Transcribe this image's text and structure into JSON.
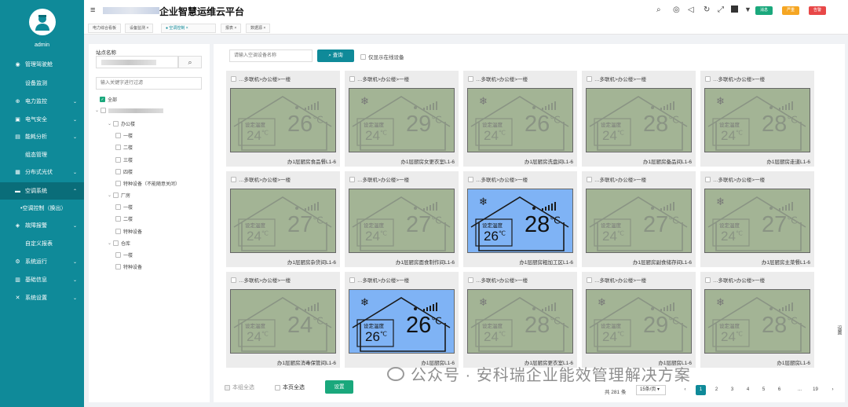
{
  "user": {
    "name": "admin"
  },
  "app": {
    "title": "企业智慧运维云平台"
  },
  "sidebar": {
    "items": [
      {
        "label": "管理驾驶舱",
        "icon": "dashboard-icon"
      },
      {
        "label": "设备监测",
        "icon": ""
      },
      {
        "label": "电力监控",
        "icon": "power-icon"
      },
      {
        "label": "电气安全",
        "icon": "shield-icon"
      },
      {
        "label": "能耗分析",
        "icon": "chart-icon"
      },
      {
        "label": "组态管理",
        "icon": ""
      },
      {
        "label": "分布式光伏",
        "icon": "solar-icon"
      },
      {
        "label": "空调系统",
        "icon": "aircon-icon"
      },
      {
        "label": "空调控制（换出）",
        "icon": ""
      },
      {
        "label": "故障报警",
        "icon": "alarm-icon"
      },
      {
        "label": "自定义报表",
        "icon": ""
      },
      {
        "label": "系统运行",
        "icon": "run-icon"
      },
      {
        "label": "基础信息",
        "icon": "info-icon"
      },
      {
        "label": "系统设置",
        "icon": "wrench-icon"
      }
    ]
  },
  "header_badges": [
    {
      "label": "消息",
      "color": "#1aa87c"
    },
    {
      "label": "严重",
      "color": "#f5a623"
    },
    {
      "label": "告警",
      "color": "#e84848"
    }
  ],
  "tabs": [
    {
      "label": "电力综合看板"
    },
    {
      "label": "设备监测 ×"
    },
    {
      "label": "● 空调控制 ×"
    },
    {
      "label": "报表 ×"
    },
    {
      "label": "数据源 ×"
    }
  ],
  "tree": {
    "station_label": "站点名称",
    "filter_placeholder": "输入关键字进行过滤",
    "nodes": [
      {
        "label": "全部"
      },
      {
        "label": "办公楼"
      },
      {
        "label": "一楼"
      },
      {
        "label": "二楼"
      },
      {
        "label": "三楼"
      },
      {
        "label": "四楼"
      },
      {
        "label": "特种设备（不能随意关闭）"
      },
      {
        "label": "厂房"
      },
      {
        "label": "一楼"
      },
      {
        "label": "二楼"
      },
      {
        "label": "特种设备"
      },
      {
        "label": "仓库"
      },
      {
        "label": "一楼"
      },
      {
        "label": "特种设备"
      }
    ]
  },
  "search": {
    "placeholder": "请输入空调设备名称",
    "button": "查询",
    "only_online": "仅显示在线设备"
  },
  "cards": [
    {
      "path": "…多联机>办公楼>一楼",
      "name": "办1层厨房食品餐L1-6",
      "set": "24",
      "cur": "26",
      "snow": false,
      "on": false
    },
    {
      "path": "…多联机>办公楼>一楼",
      "name": "办1层厨房女更衣室L1-6",
      "set": "24",
      "cur": "29",
      "snow": true,
      "on": false
    },
    {
      "path": "…多联机>办公楼>一楼",
      "name": "办1层厨房洗盘间L1-6",
      "set": "24",
      "cur": "26",
      "snow": true,
      "on": false
    },
    {
      "path": "…多联机>办公楼>一楼",
      "name": "办1层厨房备品间L1-6",
      "set": "24",
      "cur": "28",
      "snow": false,
      "on": false
    },
    {
      "path": "…多联机>办公楼>一楼",
      "name": "办1层厨房走道L1-6",
      "set": "24",
      "cur": "28",
      "snow": true,
      "on": false
    },
    {
      "path": "…多联机>办公楼>一楼",
      "name": "办1层厨房杂货间L1-6",
      "set": "24",
      "cur": "27",
      "snow": false,
      "on": false
    },
    {
      "path": "…多联机>办公楼>一楼",
      "name": "办1层厨房面食制作间L1-6",
      "set": "24",
      "cur": "27",
      "snow": false,
      "on": false
    },
    {
      "path": "…多联机>办公楼>一楼",
      "name": "办1层厨房粗加工区L1-6",
      "set": "26",
      "cur": "28",
      "snow": true,
      "on": true
    },
    {
      "path": "…多联机>办公楼>一楼",
      "name": "办1层厨房副食储存间L1-6",
      "set": "24",
      "cur": "27",
      "snow": false,
      "on": false
    },
    {
      "path": "…多联机>办公楼>一楼",
      "name": "办1层厨房主菜餐L1-6",
      "set": "24",
      "cur": "27",
      "snow": true,
      "on": false
    },
    {
      "path": "…多联机>办公楼>一楼",
      "name": "办1层厨房消毒保管间L1-6",
      "set": "24",
      "cur": "24",
      "snow": false,
      "on": false
    },
    {
      "path": "…多联机>办公楼>一楼",
      "name": "办1层厨房L1-6",
      "set": "26",
      "cur": "26",
      "snow": true,
      "on": true
    },
    {
      "path": "…多联机>办公楼>一楼",
      "name": "办1层厨房更衣室L1-6",
      "set": "24",
      "cur": "28",
      "snow": true,
      "on": false
    },
    {
      "path": "…多联机>办公楼>一楼",
      "name": "办1层厨房L1-6",
      "set": "24",
      "cur": "29",
      "snow": true,
      "on": false
    },
    {
      "path": "…多联机>办公楼>一楼",
      "name": "办1层厨房L1-6",
      "set": "24",
      "cur": "28",
      "snow": true,
      "on": false
    }
  ],
  "lcd_labels": {
    "set_label": "设定温度",
    "unit": "℃"
  },
  "footer": {
    "select_all": "本组全选",
    "select_page": "本页全选",
    "settings": "设置",
    "total": "共 281 条",
    "page_size": "15条/页",
    "pages": [
      "1",
      "2",
      "3",
      "4",
      "5",
      "6",
      "...",
      "19"
    ],
    "prev": "‹",
    "next": "›"
  },
  "watermark": "公众号 · 安科瑞企业能效管理解决方案",
  "side_tab": "设置"
}
